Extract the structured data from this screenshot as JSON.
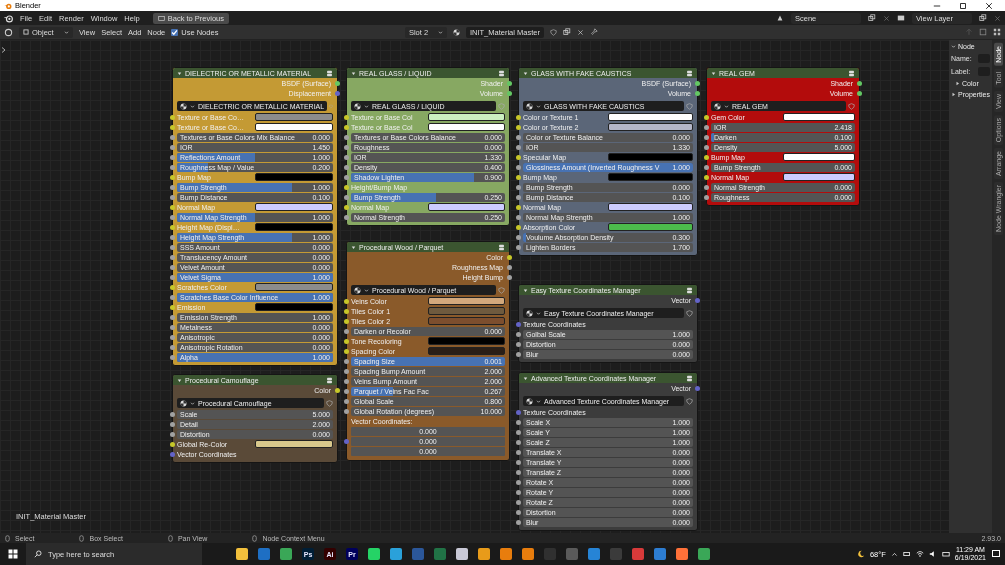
{
  "window": {
    "title": "Blender"
  },
  "menu_bar": {
    "menus": [
      "File",
      "Edit",
      "Render",
      "Window",
      "Help"
    ],
    "back_button": "Back to Previous",
    "scene": "Scene",
    "view_layer": "View Layer"
  },
  "header": {
    "mode": "Object",
    "menus": [
      "View",
      "Select",
      "Add",
      "Node"
    ],
    "use_nodes": {
      "label": "Use Nodes",
      "checked": true
    },
    "slot": "Slot 2",
    "material": "INIT_Material Master"
  },
  "nodes": [
    {
      "title": "DIELECTRIC OR METALLIC MATERIAL",
      "color": "#c49a34",
      "group": "DIELECTRIC OR METALLIC MATERIAL",
      "outputs": [
        {
          "label": "BSDF (Surface)",
          "color": "#63c763"
        },
        {
          "label": "Displacement",
          "color": "#6363c7"
        }
      ],
      "inputs": [
        {
          "kind": "color",
          "label": "Texture or Base Co…",
          "color": "#8c8c8c"
        },
        {
          "kind": "color",
          "label": "Texture or Base Co…",
          "color": "#ffffff"
        },
        {
          "kind": "value",
          "label": "Textures or Base Colors Mix Balance",
          "value": "0.000"
        },
        {
          "kind": "value",
          "label": "IOR",
          "value": "1.450"
        },
        {
          "kind": "value",
          "label": "Reflections Amount",
          "value": "1.000",
          "level": 0.5
        },
        {
          "kind": "value",
          "label": "Roughness Map / Value",
          "value": "0.200",
          "level": 0.2
        },
        {
          "kind": "color",
          "label": "Bump Map",
          "color": "#000000"
        },
        {
          "kind": "value",
          "label": "Bump Strength",
          "value": "1.000",
          "level": 0.74
        },
        {
          "kind": "value",
          "label": "Bump Distance",
          "value": "0.100"
        },
        {
          "kind": "color",
          "label": "Normal Map",
          "color": "#ccccff"
        },
        {
          "kind": "value",
          "label": "Normal Map Strength",
          "value": "1.000",
          "level": 0.5
        },
        {
          "kind": "color",
          "label": "Height Map (Displ…",
          "color": "#000000"
        },
        {
          "kind": "value",
          "label": "Height Map Strength",
          "value": "1.000",
          "level": 0.74
        },
        {
          "kind": "value",
          "label": "SSS Amount",
          "value": "0.000"
        },
        {
          "kind": "value",
          "label": "Translucency Amount",
          "value": "0.000"
        },
        {
          "kind": "value",
          "label": "Velvet Amount",
          "value": "0.000"
        },
        {
          "kind": "value",
          "label": "Velvet Sigma",
          "value": "1.000",
          "level": 1
        },
        {
          "kind": "color",
          "label": "Scratches Color",
          "color": "#8c8c8c"
        },
        {
          "kind": "value",
          "label": "Scratches Base Color Influence",
          "value": "1.000",
          "level": 1
        },
        {
          "kind": "color",
          "label": "Emission",
          "color": "#000000"
        },
        {
          "kind": "value",
          "label": "Emission Strength",
          "value": "1.000"
        },
        {
          "kind": "value",
          "label": "Metalness",
          "value": "0.000"
        },
        {
          "kind": "value",
          "label": "Anisotropic",
          "value": "0.000"
        },
        {
          "kind": "value",
          "label": "Anisotropic Rotation",
          "value": "0.000"
        },
        {
          "kind": "value",
          "label": "Alpha",
          "value": "1.000",
          "level": 1
        }
      ]
    },
    {
      "title": "Procedural Camouflage",
      "color": "#5a4a38",
      "group": "Procedural Camouflage",
      "outputs": [
        {
          "label": "Color",
          "color": "#c7c729"
        }
      ],
      "inputs": [
        {
          "kind": "value",
          "label": "Scale",
          "value": "5.000"
        },
        {
          "kind": "value",
          "label": "Detail",
          "value": "2.000"
        },
        {
          "kind": "value",
          "label": "Distortion",
          "value": "0.000"
        },
        {
          "kind": "color",
          "label": "Global Re-Color",
          "color": "#d8c88c"
        },
        {
          "kind": "label",
          "label": "Vector Coordinates",
          "color": "#6363c7"
        }
      ]
    },
    {
      "title": "REAL GLASS / LIQUID",
      "color": "#87a862",
      "group": "REAL GLASS / LIQUID",
      "outputs": [
        {
          "label": "Shader",
          "color": "#63c763"
        },
        {
          "label": "Volume",
          "color": "#63c763"
        }
      ],
      "inputs": [
        {
          "kind": "color",
          "label": "Texture or Base Col",
          "color": "#ccf0c0"
        },
        {
          "kind": "color",
          "label": "Texture or Base Col",
          "color": "#ffffff"
        },
        {
          "kind": "value",
          "label": "Textures or Base Colors  Balance",
          "value": "0.000"
        },
        {
          "kind": "value",
          "label": "Roughness",
          "value": "0.000"
        },
        {
          "kind": "value",
          "label": "IOR",
          "value": "1.330"
        },
        {
          "kind": "value",
          "label": "Density",
          "value": "0.400"
        },
        {
          "kind": "value",
          "label": "Shadow Lighten",
          "value": "0.900",
          "level": 0.8
        },
        {
          "kind": "label",
          "label": "Height/Bump Map",
          "color": "#c7c729"
        },
        {
          "kind": "value",
          "label": "Bump Strength",
          "value": "0.250",
          "level": 0.55
        },
        {
          "kind": "color",
          "label": "Normal Map",
          "color": "#ccccff"
        },
        {
          "kind": "value",
          "label": "Normal Strength",
          "value": "0.250"
        }
      ]
    },
    {
      "title": "Procedural Wood / Parquet",
      "color": "#8a5a2a",
      "group": "Procedural Wood / Parquet",
      "outputs": [
        {
          "label": "Color",
          "color": "#c7c729"
        },
        {
          "label": "Roughness Map",
          "color": "#a1a1a1"
        },
        {
          "label": "Height Bump",
          "color": "#a1a1a1"
        }
      ],
      "inputs": [
        {
          "kind": "color",
          "label": "Veins Color",
          "color": "#d2a87c"
        },
        {
          "kind": "color",
          "label": "Tiles Color 1",
          "color": "#6e5a3e"
        },
        {
          "kind": "color",
          "label": "Tiles Color 2",
          "color": "#7c4e2e"
        },
        {
          "kind": "value",
          "label": "Darken or Recolor",
          "value": "0.000"
        },
        {
          "kind": "color",
          "label": "Tone Recoloring",
          "color": "#000000"
        },
        {
          "kind": "color",
          "label": "Spacing Color",
          "color": "#2a1e16"
        },
        {
          "kind": "value",
          "label": "Spacing Size",
          "value": "0.001",
          "level": 1
        },
        {
          "kind": "value",
          "label": "Spacing Bump Amount",
          "value": "2.000"
        },
        {
          "kind": "value",
          "label": "Veins Bump Amount",
          "value": "2.000"
        },
        {
          "kind": "value",
          "label": "Parquet / Veins Fac Fac",
          "value": "0.267",
          "level": 0.27
        },
        {
          "kind": "value",
          "label": "Global Scale",
          "value": "0.800"
        },
        {
          "kind": "value",
          "label": "Global Rotation (degrees)",
          "value": "10.000"
        },
        {
          "kind": "label",
          "label": "Vector Coordinates:"
        },
        {
          "kind": "vector",
          "values": [
            "0.000",
            "0.000",
            "0.000"
          ]
        }
      ]
    },
    {
      "title": "GLASS WITH FAKE CAUSTICS",
      "color": "#5b6678",
      "group": "GLASS WITH FAKE CAUSTICS",
      "outputs": [
        {
          "label": "BSDF (Surface)",
          "color": "#63c763"
        },
        {
          "label": "Volume",
          "color": "#63c763"
        }
      ],
      "inputs": [
        {
          "kind": "color",
          "label": "Color or Texture 1",
          "color": "#ffffff"
        },
        {
          "kind": "color",
          "label": "Color or Texture 2",
          "color": "#b4b6c8"
        },
        {
          "kind": "value",
          "label": "Color or Texture Balance",
          "value": "0.000"
        },
        {
          "kind": "value",
          "label": "IOR",
          "value": "1.330"
        },
        {
          "kind": "color",
          "label": "Specular Map",
          "color": "#000000"
        },
        {
          "kind": "value",
          "label": "Glossiness Amount (Inverted Roughness V",
          "value": "1.000",
          "level": 1
        },
        {
          "kind": "color",
          "label": "Bump Map",
          "color": "#000000"
        },
        {
          "kind": "value",
          "label": "Bump Strength",
          "value": "0.000"
        },
        {
          "kind": "value",
          "label": "Bump Distance",
          "value": "0.100"
        },
        {
          "kind": "color",
          "label": "Normal Map",
          "color": "#ccccff"
        },
        {
          "kind": "value",
          "label": "Normal Map Strength",
          "value": "1.000"
        },
        {
          "kind": "color",
          "label": "Absorption Color",
          "color": "#4cbb4c"
        },
        {
          "kind": "value",
          "label": "Voulume Absorption Density",
          "value": "0.300",
          "level": 0.02
        },
        {
          "kind": "value",
          "label": "Lighten Borders",
          "value": "1.700"
        }
      ]
    },
    {
      "title": "Easy Texture Coordinates Manager",
      "color": "#3c3c3c",
      "group": "Easy Texture Coordinates Manager",
      "outputs": [
        {
          "label": "Vector",
          "color": "#6363c7"
        }
      ],
      "inputs": [
        {
          "kind": "label",
          "label": "Texture Coordinates",
          "color": "#6363c7"
        },
        {
          "kind": "value",
          "label": "Golbal Scale",
          "value": "1.000"
        },
        {
          "kind": "value",
          "label": "Distortion",
          "value": "0.000"
        },
        {
          "kind": "value",
          "label": "Blur",
          "value": "0.000"
        }
      ]
    },
    {
      "title": "Advanced Texture Coordinates Manager",
      "color": "#3c3c3c",
      "group": "Advanced Texture Coordinates Manager",
      "outputs": [
        {
          "label": "Vector",
          "color": "#6363c7"
        }
      ],
      "inputs": [
        {
          "kind": "label",
          "label": "Texture Coordinates",
          "color": "#6363c7"
        },
        {
          "kind": "value",
          "label": "Scale X",
          "value": "1.000"
        },
        {
          "kind": "value",
          "label": "Scale Y",
          "value": "1.000"
        },
        {
          "kind": "value",
          "label": "Scale Z",
          "value": "1.000"
        },
        {
          "kind": "value",
          "label": "Translate X",
          "value": "0.000"
        },
        {
          "kind": "value",
          "label": "Translate Y",
          "value": "0.000"
        },
        {
          "kind": "value",
          "label": "Translate Z",
          "value": "0.000"
        },
        {
          "kind": "value",
          "label": "Rotate X",
          "value": "0.000"
        },
        {
          "kind": "value",
          "label": "Rotate Y",
          "value": "0.000"
        },
        {
          "kind": "value",
          "label": "Rotate Z",
          "value": "0.000"
        },
        {
          "kind": "value",
          "label": "Distortion",
          "value": "0.000"
        },
        {
          "kind": "value",
          "label": "Blur",
          "value": "0.000"
        }
      ]
    },
    {
      "title": "REAL GEM",
      "color": "#b30c0c",
      "group": "REAL GEM",
      "outputs": [
        {
          "label": "Shader",
          "color": "#63c763"
        },
        {
          "label": "Volume",
          "color": "#63c763"
        }
      ],
      "inputs": [
        {
          "kind": "color",
          "label": "Gem Color",
          "color": "#ffffff"
        },
        {
          "kind": "value",
          "label": "IOR",
          "value": "2.418"
        },
        {
          "kind": "value",
          "label": "Darken",
          "value": "0.100",
          "level": 0.02
        },
        {
          "kind": "value",
          "label": "Density",
          "value": "5.000"
        },
        {
          "kind": "color",
          "label": "Bump Map",
          "color": "#ffffff"
        },
        {
          "kind": "value",
          "label": "Bump Strength",
          "value": "0.000"
        },
        {
          "kind": "color",
          "label": "Normal Map",
          "color": "#ccccff"
        },
        {
          "kind": "value",
          "label": "Normal Strength",
          "value": "0.000"
        },
        {
          "kind": "value",
          "label": "Roughness",
          "value": "0.000"
        }
      ]
    }
  ],
  "canvas_label": "INIT_Material Master",
  "sidebar": {
    "tabs": [
      {
        "label": "Node",
        "selected": true
      },
      {
        "label": "Tool",
        "selected": false
      },
      {
        "label": "View",
        "selected": false
      },
      {
        "label": "Options",
        "selected": false
      },
      {
        "label": "Arrange",
        "selected": false
      },
      {
        "label": "Node Wrangler",
        "selected": false
      }
    ],
    "panel": "Node",
    "name_label": "Name:",
    "label_label": "Label:",
    "subpanels": [
      {
        "label": "Color",
        "expanded": false
      },
      {
        "label": "Properties",
        "expanded": false
      }
    ]
  },
  "status_bar": {
    "hints": [
      "Select",
      "Box Select",
      "Pan View",
      "Node Context Menu"
    ],
    "version": "2.93.0"
  },
  "taskbar": {
    "search": {
      "placeholder": "Type here to search"
    },
    "apps": [
      {
        "color": "#f2c03c"
      },
      {
        "color": "#1e6fc4"
      },
      {
        "color": "#3aa757"
      },
      {
        "color": "#001e36",
        "label": "Ps"
      },
      {
        "color": "#330000",
        "label": "Ai"
      },
      {
        "color": "#00005b",
        "label": "Pr"
      },
      {
        "color": "#25d366"
      },
      {
        "color": "#2aa1da"
      },
      {
        "color": "#2b579a"
      },
      {
        "color": "#217346"
      },
      {
        "color": "#c9c9d6"
      },
      {
        "color": "#e89b1a"
      },
      {
        "color": "#e87d0d"
      },
      {
        "color": "#e87d0d"
      },
      {
        "color": "#303030"
      },
      {
        "color": "#5a5a5a"
      },
      {
        "color": "#2684d6"
      },
      {
        "color": "#3b3b3b"
      },
      {
        "color": "#d83a3a"
      },
      {
        "color": "#2d7dd2"
      },
      {
        "color": "#ff7139"
      },
      {
        "color": "#3aa757"
      }
    ],
    "weather": "68°F",
    "time": "11:29 AM",
    "date": "6/19/2021"
  }
}
